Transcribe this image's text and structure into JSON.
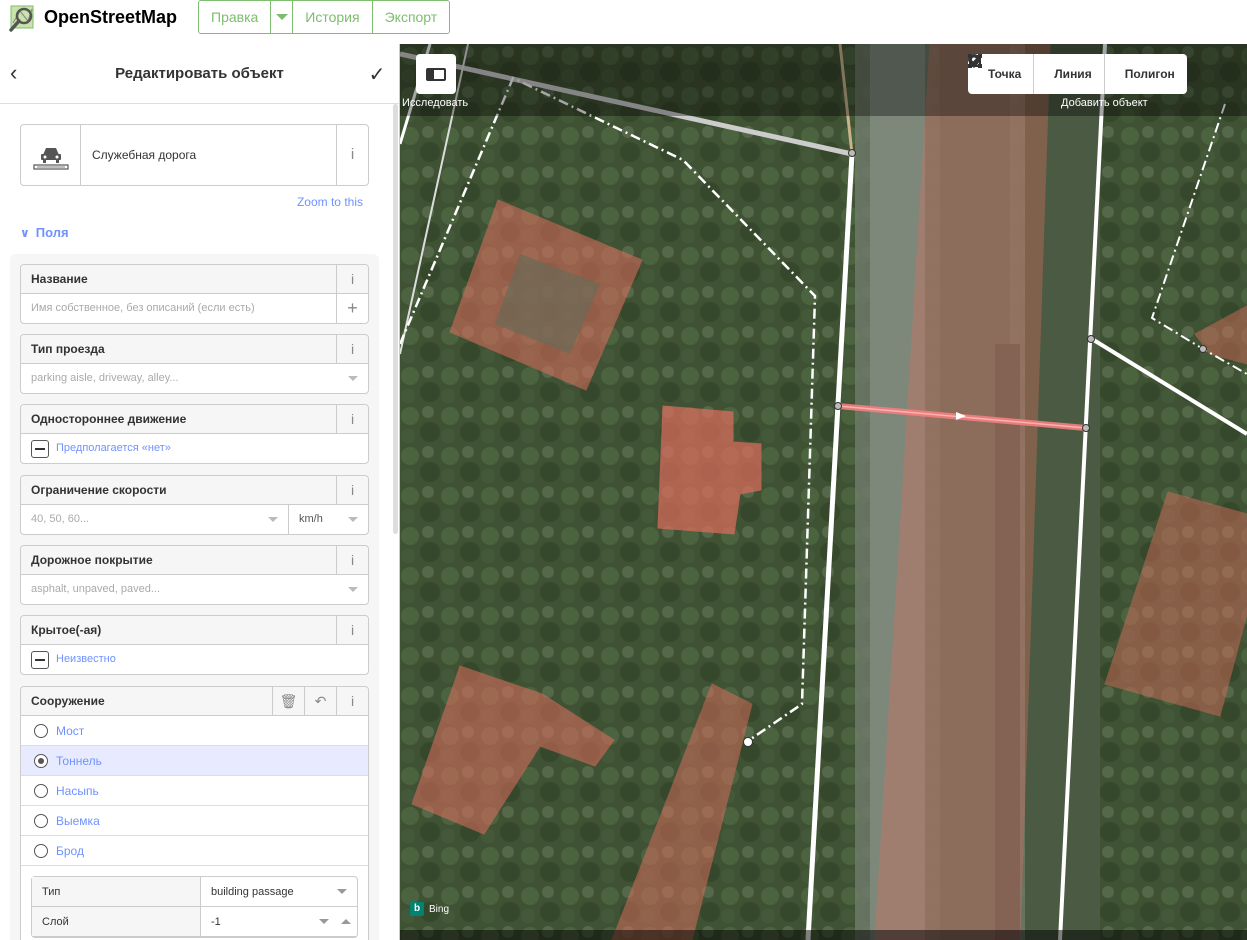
{
  "header": {
    "app_name": "OpenStreetMap",
    "nav": {
      "edit": "Правка",
      "history": "История",
      "export": "Экспорт"
    }
  },
  "sidebar": {
    "title": "Редактировать объект",
    "preset": {
      "name": "Служебная дорога",
      "icon": "service-road-icon"
    },
    "zoom_to": "Zoom to this",
    "fields_heading": "Поля",
    "fields": {
      "name": {
        "label": "Название",
        "placeholder": "Имя собственное, без описаний (если есть)"
      },
      "service": {
        "label": "Тип проезда",
        "placeholder": "parking aisle, driveway, alley..."
      },
      "oneway": {
        "label": "Одностороннее движение",
        "value": "Предполагается «нет»"
      },
      "maxspeed": {
        "label": "Ограничение скорости",
        "placeholder": "40, 50, 60...",
        "unit": "km/h"
      },
      "surface": {
        "label": "Дорожное покрытие",
        "placeholder": "asphalt, unpaved, paved..."
      },
      "covered": {
        "label": "Крытое(-ая)",
        "value": "Неизвестно"
      },
      "structure": {
        "label": "Сооружение",
        "options": [
          {
            "label": "Мост",
            "selected": false
          },
          {
            "label": "Тоннель",
            "selected": true
          },
          {
            "label": "Насыпь",
            "selected": false
          },
          {
            "label": "Выемка",
            "selected": false
          },
          {
            "label": "Брод",
            "selected": false
          }
        ],
        "subfields": [
          {
            "key": "Тип",
            "value": "building passage"
          },
          {
            "key": "Слой",
            "value": "-1"
          }
        ]
      }
    }
  },
  "map": {
    "explore_label": "Исследовать",
    "add_label": "Добавить объект",
    "tools": {
      "point": "Точка",
      "line": "Линия",
      "area": "Полигон"
    },
    "imagery": "Bing"
  },
  "colors": {
    "accent_green": "#7ebc6f",
    "link_blue": "#7092ff",
    "building_fill": "#e06e5f",
    "selected_way": "#f08080"
  }
}
